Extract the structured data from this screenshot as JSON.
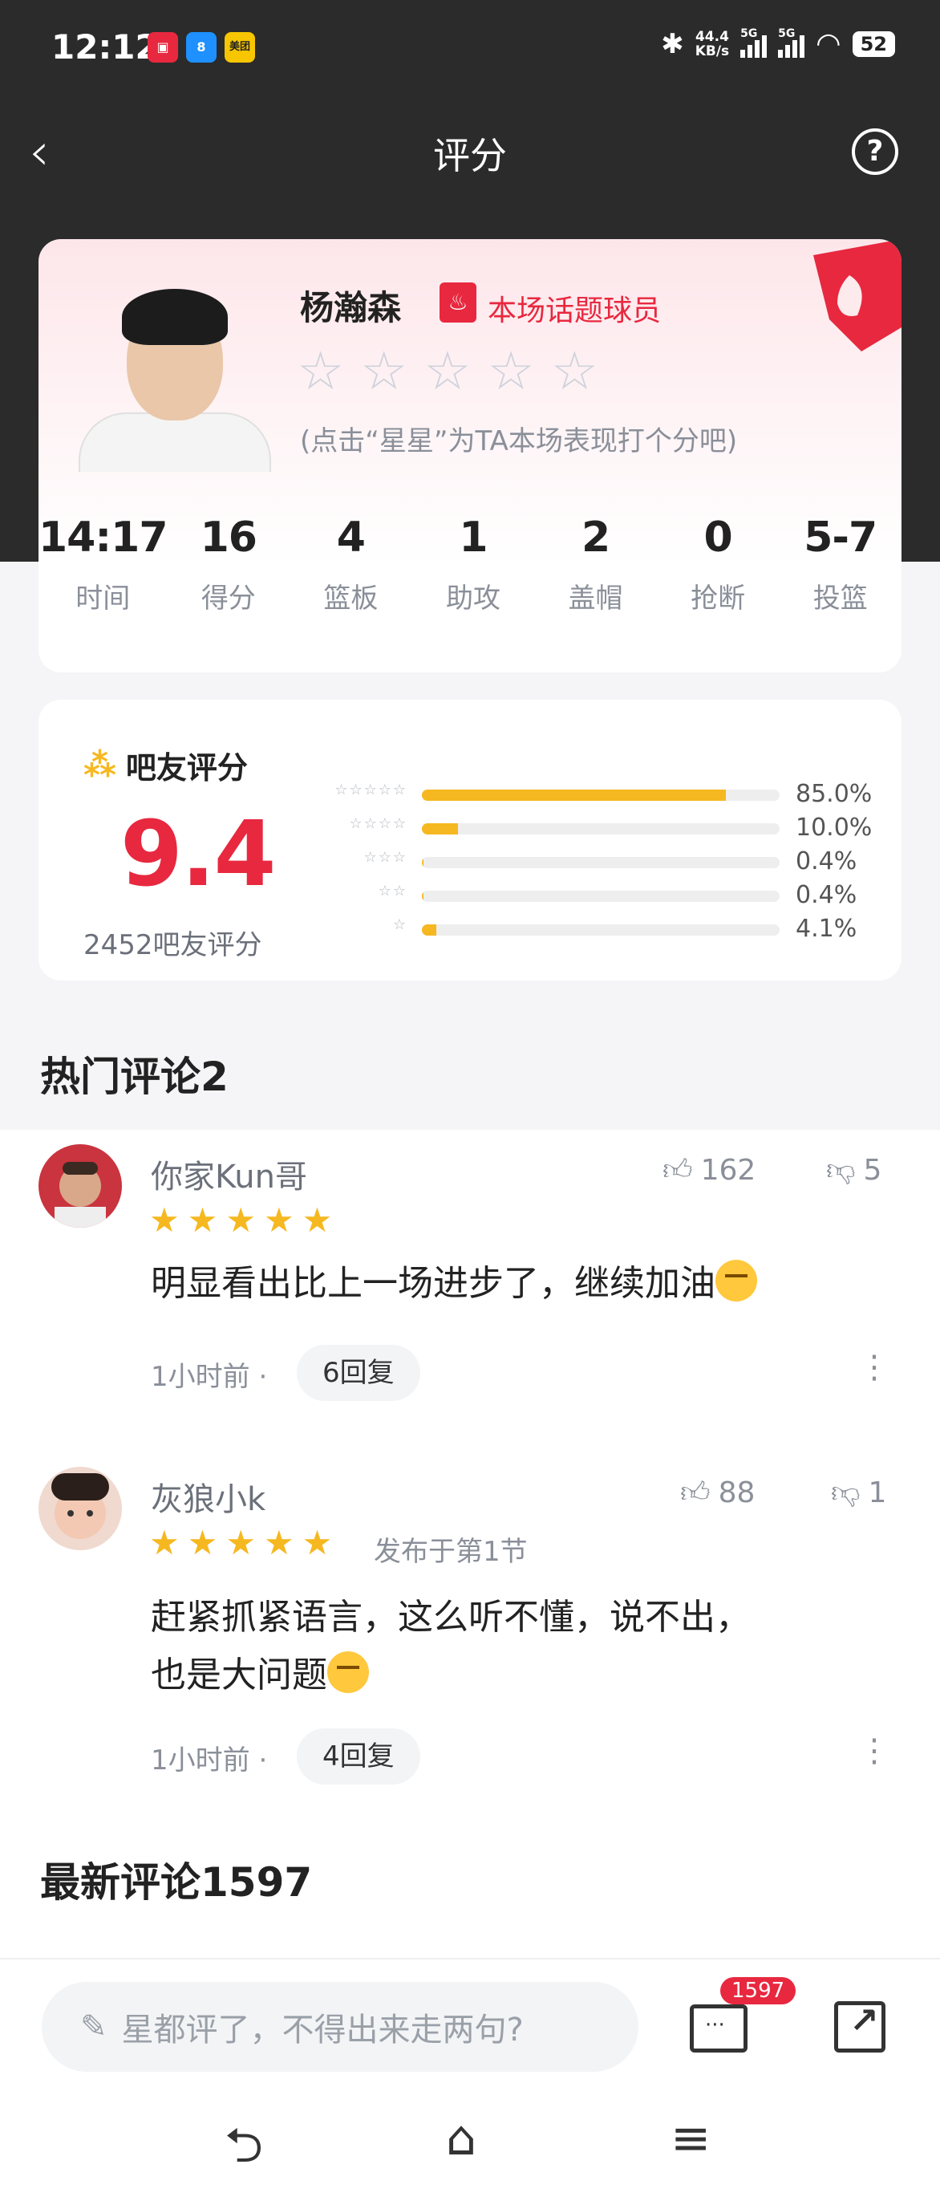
{
  "status_bar": {
    "time": "12:12",
    "apps": [
      "app-1",
      "app-8",
      "美团"
    ],
    "net_speed_value": "44.4",
    "net_speed_unit": "KB/s",
    "signal_labels": [
      "5G",
      "5G"
    ],
    "battery": "52"
  },
  "nav": {
    "title": "评分"
  },
  "player": {
    "name": "杨瀚森",
    "tag": "本场话题球员",
    "hint": "(点击“星星”为TA本场表现打个分吧)",
    "stats": [
      {
        "value": "14:17",
        "label": "时间"
      },
      {
        "value": "16",
        "label": "得分"
      },
      {
        "value": "4",
        "label": "篮板"
      },
      {
        "value": "1",
        "label": "助攻"
      },
      {
        "value": "2",
        "label": "盖帽"
      },
      {
        "value": "0",
        "label": "抢断"
      },
      {
        "value": "5-7",
        "label": "投篮"
      }
    ]
  },
  "rating": {
    "title": "吧友评分",
    "score": "9.4",
    "count_text": "2452吧友评分",
    "distribution": [
      {
        "stars": 5,
        "percent": 85.0,
        "label": "85.0%"
      },
      {
        "stars": 4,
        "percent": 10.0,
        "label": "10.0%"
      },
      {
        "stars": 3,
        "percent": 0.4,
        "label": "0.4%"
      },
      {
        "stars": 2,
        "percent": 0.4,
        "label": "0.4%"
      },
      {
        "stars": 1,
        "percent": 4.1,
        "label": "4.1%"
      }
    ]
  },
  "hot_comments": {
    "title": "热门评论2",
    "items": [
      {
        "user": "你家Kun哥",
        "stars": 5,
        "meta": "",
        "likes": "162",
        "dislikes": "5",
        "text": "明显看出比上一场进步了，继续加油",
        "time": "1小时前",
        "replies": "6回复"
      },
      {
        "user": "灰狼小k",
        "stars": 5,
        "meta": "发布于第1节",
        "likes": "88",
        "dislikes": "1",
        "text_line1": "赶紧抓紧语言，这么听不懂，说不出，",
        "text_line2": "也是大问题",
        "time": "1小时前",
        "replies": "4回复"
      }
    ]
  },
  "latest": {
    "title": "最新评论1597"
  },
  "bottom": {
    "placeholder": "星都评了，不得出来走两句?",
    "comment_count": "1597"
  },
  "colors": {
    "accent_red": "#e8283f",
    "star_gold": "#f6b820",
    "header_dark": "#2b2b2b"
  }
}
